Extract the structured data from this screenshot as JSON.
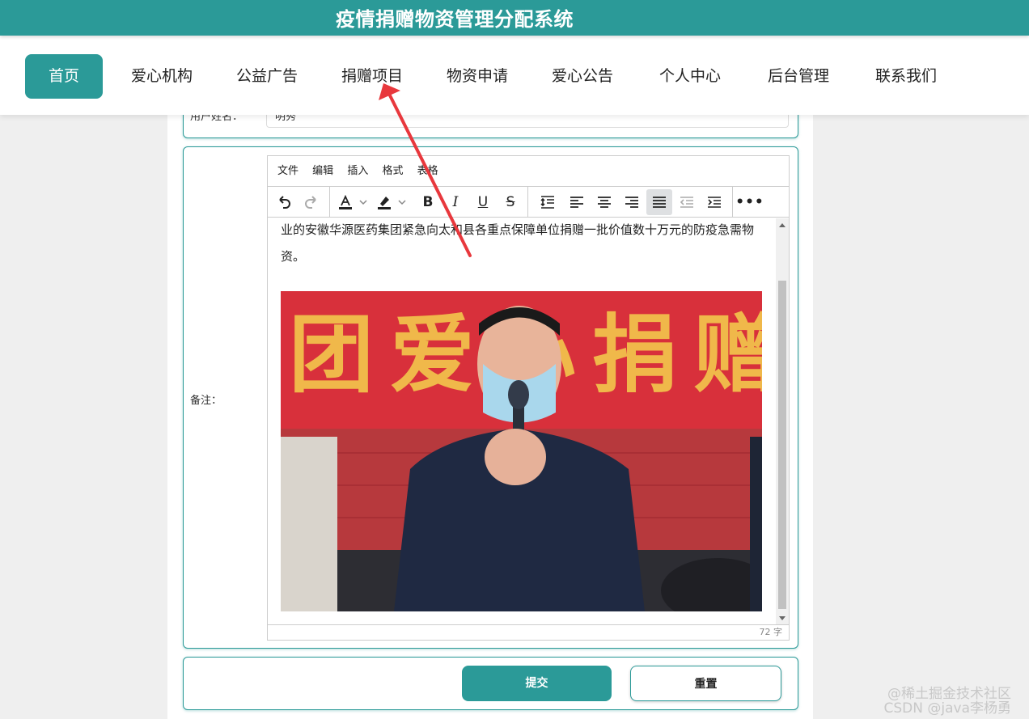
{
  "header": {
    "title": "疫情捐赠物资管理分配系统"
  },
  "nav": {
    "items": [
      {
        "label": "首页",
        "active": true
      },
      {
        "label": "爱心机构"
      },
      {
        "label": "公益广告"
      },
      {
        "label": "捐赠项目"
      },
      {
        "label": "物资申请"
      },
      {
        "label": "爱心公告"
      },
      {
        "label": "个人中心"
      },
      {
        "label": "后台管理"
      },
      {
        "label": "联系我们"
      }
    ]
  },
  "form": {
    "partial_field": {
      "label": "用户姓名：",
      "value": "明秀"
    },
    "remark_label": "备注：",
    "editor": {
      "menu": [
        "文件",
        "编辑",
        "插入",
        "格式",
        "表格"
      ],
      "body_text": "业的安徽华源医药集团紧急向太和县各重点保障单位捐赠一批价值数十万元的防疫急需物资。",
      "image_banner_text": "团爱心捐赠",
      "word_count": "72 字"
    },
    "buttons": {
      "submit": "提交",
      "reset": "重置"
    }
  },
  "watermark": {
    "line1": "@稀土掘金技术社区",
    "line2": "CSDN @java李杨勇"
  },
  "colors": {
    "primary": "#2b9a98",
    "annotation_arrow": "#e8383d"
  }
}
